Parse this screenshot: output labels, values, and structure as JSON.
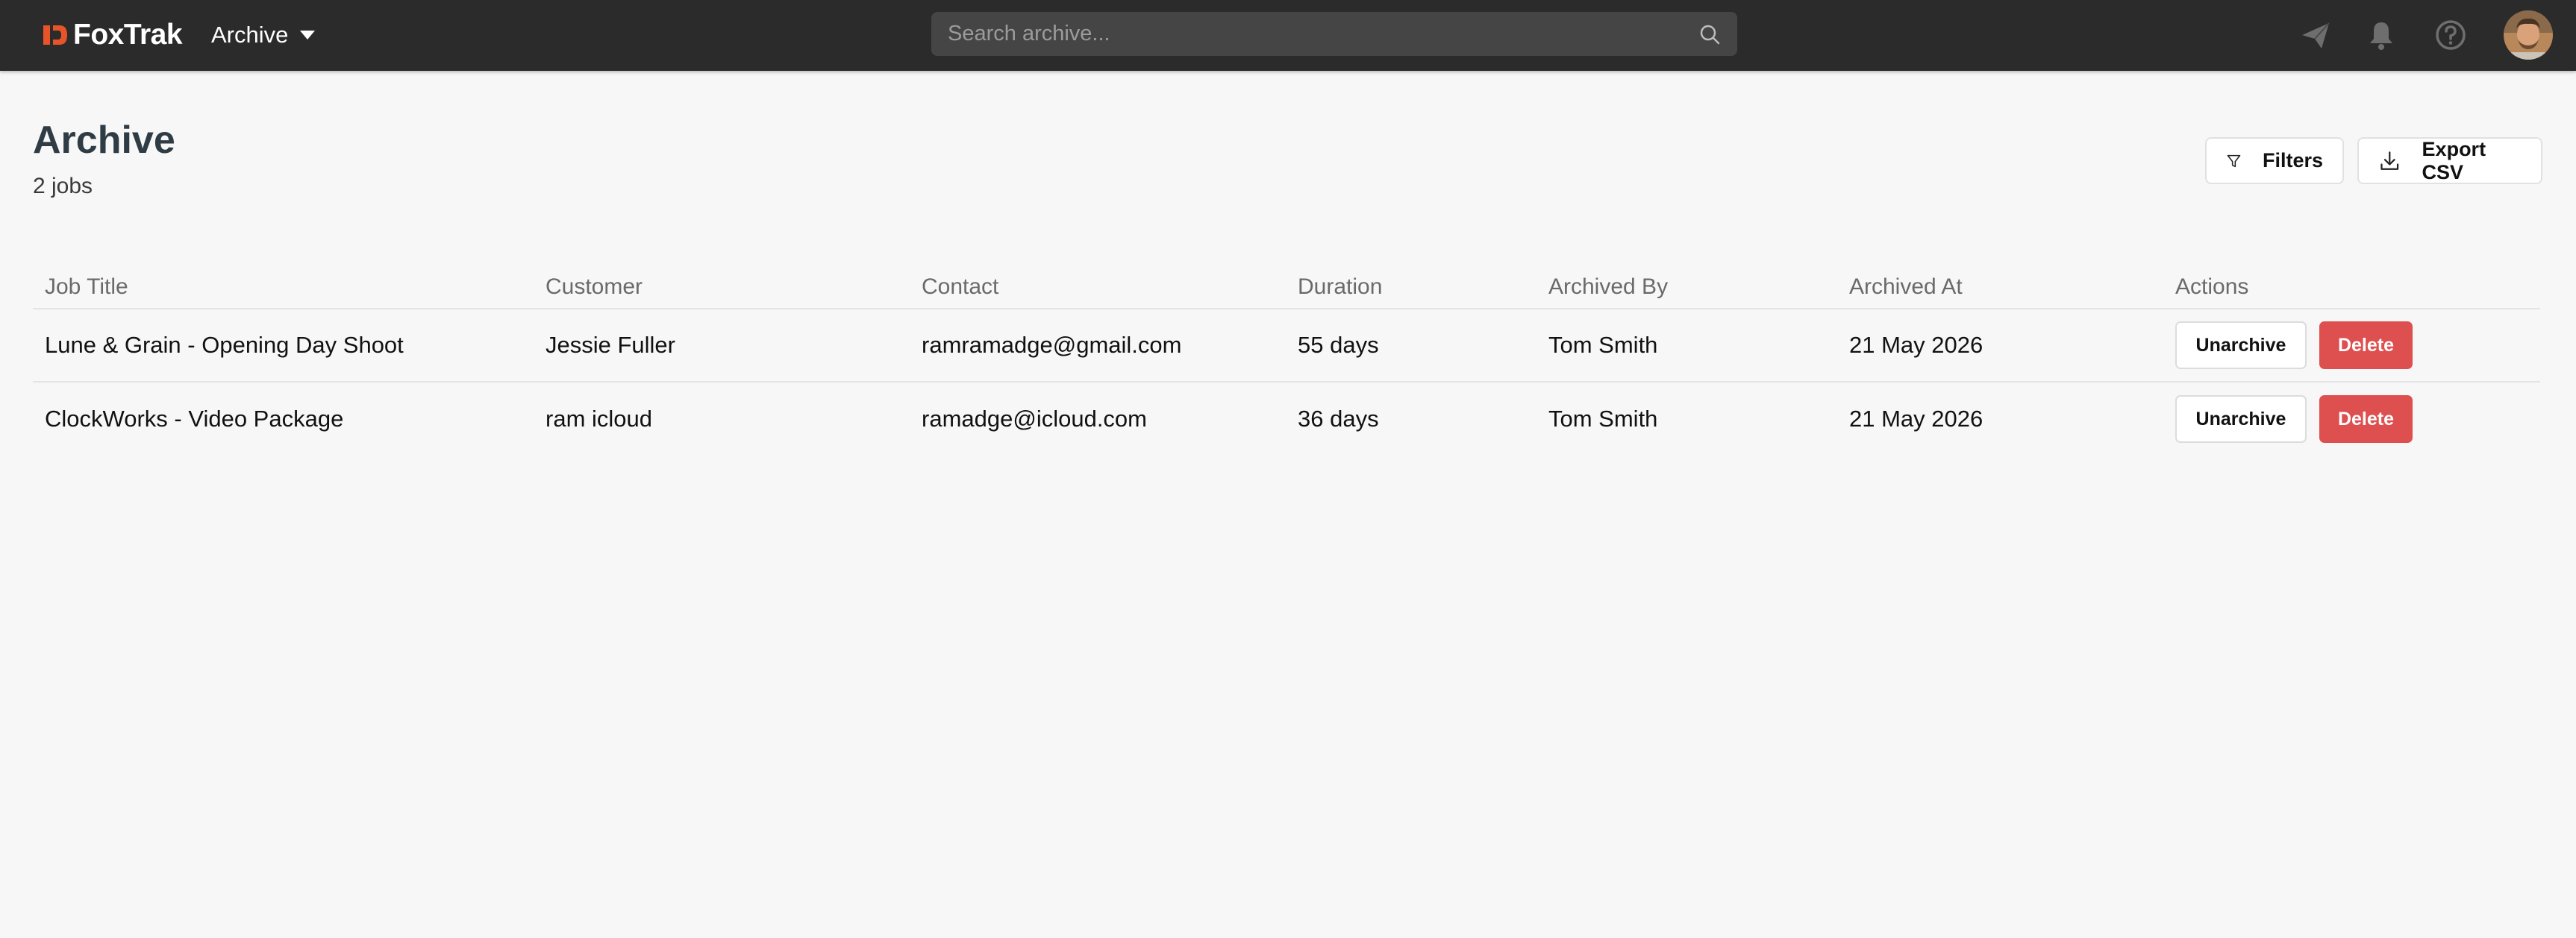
{
  "app": {
    "brand": "FoxTrak",
    "section": "Archive",
    "accent_color": "#e8542a",
    "topbar_color": "#2b2b2b"
  },
  "search": {
    "placeholder": "Search archive..."
  },
  "topbar_icons": [
    "send-icon",
    "bell-icon",
    "help-icon"
  ],
  "page": {
    "title": "Archive",
    "count": "2 jobs",
    "filters_label": "Filters",
    "export_label": "Export CSV"
  },
  "table": {
    "headers": {
      "job_title": "Job Title",
      "customer": "Customer",
      "contact": "Contact",
      "duration": "Duration",
      "archived_by": "Archived By",
      "archived_at": "Archived At",
      "actions": "Actions"
    },
    "rows": [
      {
        "job_title": "Lune & Grain - Opening Day Shoot",
        "customer": "Jessie Fuller",
        "contact": "ramramadge@gmail.com",
        "duration": "55 days",
        "archived_by": "Tom Smith",
        "archived_at": "21 May 2026",
        "unarchive_label": "Unarchive",
        "delete_label": "Delete"
      },
      {
        "job_title": "ClockWorks - Video Package",
        "customer": "ram icloud",
        "contact": "ramadge@icloud.com",
        "duration": "36 days",
        "archived_by": "Tom Smith",
        "archived_at": "21 May 2026",
        "unarchive_label": "Unarchive",
        "delete_label": "Delete"
      }
    ]
  },
  "colors": {
    "delete_button": "#de4f4f",
    "title_text": "#2f3c45",
    "page_background": "#f7f7f7"
  }
}
